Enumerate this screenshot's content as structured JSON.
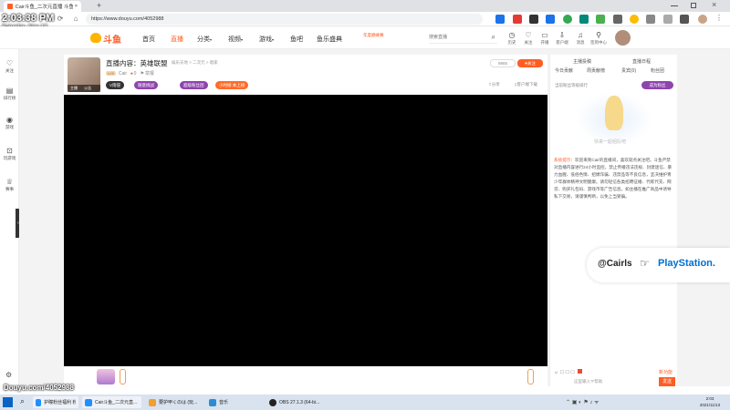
{
  "browser": {
    "tabs": [
      {
        "label": "Cair斗鱼_二次元直播 斗鱼直播",
        "active": true
      },
      {
        "label": "",
        "active": false
      }
    ],
    "url": "https://www.douyu.com/4052988",
    "nav": {
      "back": "←",
      "forward": "→",
      "reload": "⟳",
      "home": "⌂",
      "new_tab": "+",
      "close": "×"
    }
  },
  "clock_overlay": {
    "time": "2:03:38 PM",
    "date": "Saturday, Nov 13"
  },
  "watermark": "Douyu.com/4052988",
  "header": {
    "logo_text": "斗鱼",
    "nav_items": [
      {
        "label": "首页",
        "active": false
      },
      {
        "label": "直播",
        "active": true
      },
      {
        "label": "分类",
        "active": false
      },
      {
        "label": "视频",
        "active": false
      },
      {
        "label": "游戏",
        "active": false
      },
      {
        "label": "鱼吧",
        "active": false
      },
      {
        "label": "鱼乐盛典",
        "active": false
      }
    ],
    "promo_badge": "年度巅峰赛",
    "search_placeholder": "搜索直播",
    "icons": [
      {
        "label": "历史",
        "icon": "clock-icon"
      },
      {
        "label": "关注",
        "icon": "heart-icon"
      },
      {
        "label": "开播",
        "icon": "camera-icon"
      },
      {
        "label": "客户端",
        "icon": "download-icon"
      },
      {
        "label": "消息",
        "icon": "bell-icon"
      },
      {
        "label": "签到中心",
        "icon": "gift-icon"
      }
    ]
  },
  "sidebar": {
    "items": [
      {
        "label": "关注",
        "icon": "heart-icon"
      },
      {
        "label": "排行榜",
        "icon": "list-icon"
      },
      {
        "label": "游戏",
        "icon": "game-icon"
      },
      {
        "label": "玩游戏",
        "icon": "controller-icon"
      },
      {
        "label": "赛事",
        "icon": "trophy-icon"
      }
    ]
  },
  "room": {
    "title": "直播内容：英雄联盟",
    "breadcrumb": "娱乐天地 > 二次元 > 唱家",
    "streamer": "Cair",
    "avatar_badge": "主播",
    "avatar_tag": "公告",
    "level": "LV5",
    "stats": "0",
    "report": "举报",
    "hot": "9865",
    "follow_label": "关注",
    "tags": [
      {
        "label": "V雨侵",
        "color": "#333333"
      },
      {
        "label": "随意挑战",
        "color": "#8e44ad"
      },
      {
        "label": "超级粉丝团",
        "color": "#8e44ad"
      },
      {
        "label": "小时榜 本上榜",
        "color": "#ff6b2b"
      }
    ],
    "share": "分享",
    "client": "客户端下载"
  },
  "chat": {
    "header_links": [
      "主播投稿",
      "直播日程"
    ],
    "tabs": [
      "今日贡献",
      "周贡献榜",
      "贵宾(0)",
      "粉丝团"
    ],
    "fan_rank_label": "当前粉丝等级排行",
    "become_fan": "成为粉丝",
    "empty_text": "快来一起组队吧",
    "system_label": "系统提示",
    "system_message": "欢迎来到Cair的直播间，喜欢就点关注吧。斗鱼严禁对直播内容进行24小时监控，禁止传播违法违规、封建迷信、暴力血腥、低俗色情、招嫖诈骗、违禁品等不良信息，坚决维护青少年群体精神文明健康。请勿轻信各类招聘征婚、代练代充、网贷、购买礼包码、游戏币等广告信息。如主播在推广商品中诱导私下交易，请谨慎判断，以免上当受骗。",
    "input_placeholder": "这里输入'#'帮助",
    "send_label": "发送",
    "footer_link": "新功能",
    "footer_count": "0"
  },
  "overlay_banner": {
    "handle": "@Cairls",
    "brand": "PlayStation."
  },
  "taskbar": {
    "items": [
      {
        "label": "护瞳粉丝福利 粉丝...",
        "color": "#1e90ff"
      },
      {
        "label": "Cair斗鱼_二次元直...",
        "color": "#1e90ff"
      },
      {
        "label": "要护甲くのは (玩...",
        "color": "#f0a030"
      },
      {
        "label": "音乐",
        "color": "#2a8dd4"
      },
      {
        "label": "OBS 27.1.3 (64-bi...",
        "color": "#222222"
      }
    ],
    "time": "2:03",
    "date": "2021/11/13"
  },
  "colors": {
    "accent": "#ff5d23",
    "purple": "#8e44ad"
  }
}
